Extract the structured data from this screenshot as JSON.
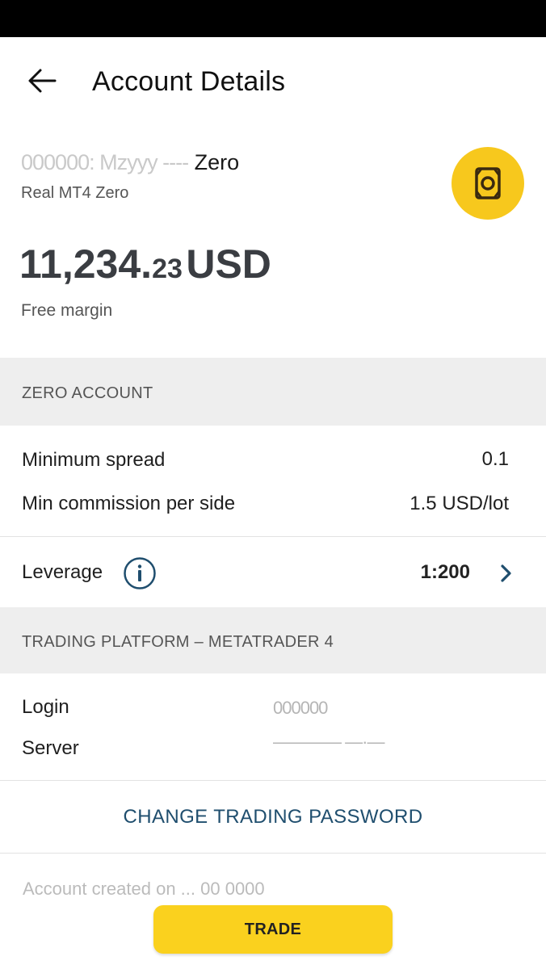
{
  "header": {
    "title": "Account Details"
  },
  "account": {
    "name_masked": "000000: Mzyyy ----",
    "name_suffix": "Zero",
    "subtitle": "Real MT4 Zero"
  },
  "balance": {
    "integer": "11,234.",
    "decimals": "23",
    "currency": "USD",
    "label": "Free margin"
  },
  "account_section": {
    "title": "ZERO ACCOUNT",
    "rows": [
      {
        "label": "Minimum spread",
        "value": "0.1"
      },
      {
        "label": "Min commission per side",
        "value": "1.5 USD/lot"
      }
    ],
    "leverage": {
      "label": "Leverage",
      "value": "1:200"
    }
  },
  "platform_section": {
    "title": "TRADING PLATFORM – METATRADER 4",
    "login_label": "Login",
    "login_value": "000000",
    "server_label": "Server",
    "server_value": "———— —·—"
  },
  "actions": {
    "change_password": "CHANGE TRADING PASSWORD",
    "trade": "TRADE"
  },
  "footer_text": "Account created on ... 00 0000",
  "colors": {
    "accent_yellow": "#f7c81d",
    "link_blue": "#1f4e6e",
    "section_bg": "#eeeeee"
  },
  "icons": [
    "back-arrow-icon",
    "money-bill-icon",
    "info-icon",
    "chevron-right-icon"
  ]
}
